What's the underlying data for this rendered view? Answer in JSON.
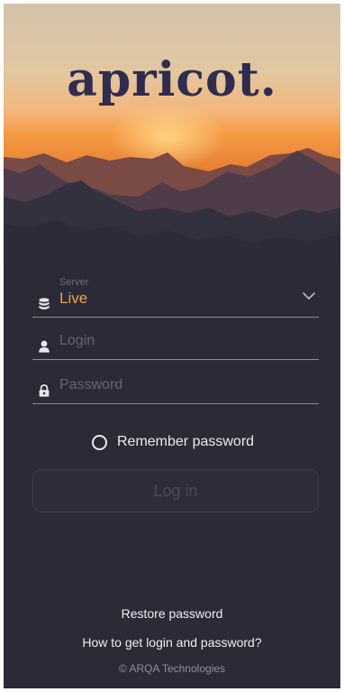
{
  "brand": {
    "logo_text": "apricot."
  },
  "form": {
    "server_caption": "Server",
    "server_value": "Live",
    "login_placeholder": "Login",
    "login_value": "",
    "password_placeholder": "Password",
    "password_value": "",
    "remember_label": "Remember password",
    "remember_checked": false,
    "login_button_label": "Log in",
    "login_button_enabled": false
  },
  "footer": {
    "restore_link": "Restore password",
    "help_link": "How to get login and password?",
    "copyright": "© ARQA Technologies"
  },
  "icons": {
    "server": "database-icon",
    "login": "user-icon",
    "password": "lock-icon",
    "dropdown": "chevron-down-icon"
  },
  "colors": {
    "accent": "#f2a24b",
    "background": "#2a2b36",
    "brand_text": "#2f2d4f",
    "field_line": "#8d8d98"
  }
}
